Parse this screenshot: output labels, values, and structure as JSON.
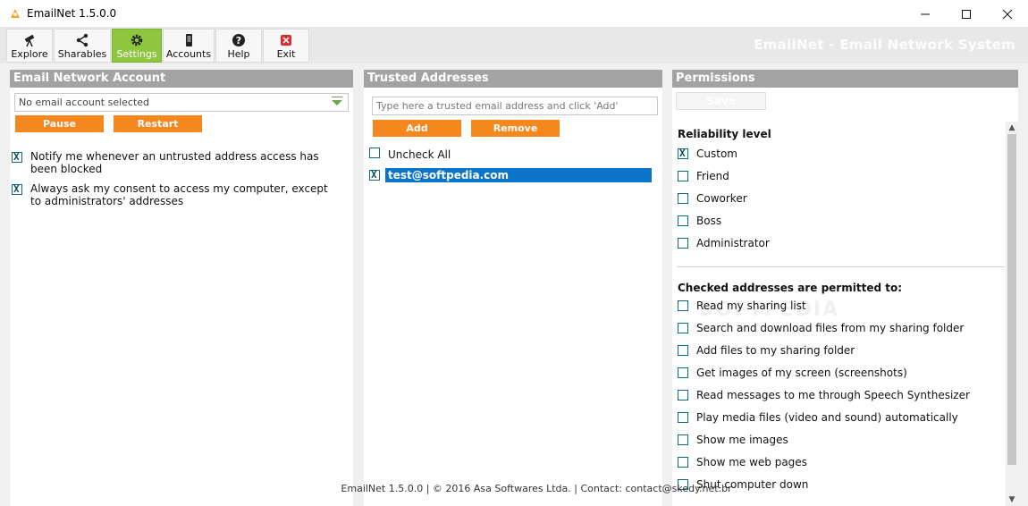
{
  "window": {
    "title": "EmailNet 1.5.0.0",
    "icon": "app-logo-icon"
  },
  "toolbar": {
    "items": [
      {
        "label": "Explore",
        "icon": "telescope-icon"
      },
      {
        "label": "Sharables",
        "icon": "share-icon"
      },
      {
        "label": "Settings",
        "icon": "gear-icon"
      },
      {
        "label": "Accounts",
        "icon": "phone-icon"
      },
      {
        "label": "Help",
        "icon": "question-icon"
      },
      {
        "label": "Exit",
        "icon": "close-icon"
      }
    ],
    "active": "Settings",
    "brand": "EmailNet - Email Network System",
    "active_color": "#8dc63f"
  },
  "account_panel": {
    "title": "Email Network Account",
    "account_select": "No email account selected",
    "pause_label": "Pause",
    "restart_label": "Restart",
    "options": [
      {
        "label": "Notify me whenever an untrusted address access has been blocked",
        "checked": true
      },
      {
        "label": "Always ask my consent to access my computer, except to administrators' addresses",
        "checked": true
      }
    ]
  },
  "trusted_panel": {
    "title": "Trusted Addresses",
    "input_placeholder": "Type here a trusted email address and click 'Add'",
    "add_label": "Add",
    "remove_label": "Remove",
    "uncheck_all_label": "Uncheck All",
    "addresses": [
      {
        "email": "test@softpedia.com",
        "checked": true
      }
    ]
  },
  "permissions_panel": {
    "title": "Permissions",
    "save_label": "Save",
    "reliability_title": "Reliability level",
    "reliability_levels": [
      {
        "label": "Custom",
        "checked": true
      },
      {
        "label": "Friend",
        "checked": false
      },
      {
        "label": "Coworker",
        "checked": false
      },
      {
        "label": "Boss",
        "checked": false
      },
      {
        "label": "Administrator",
        "checked": false
      }
    ],
    "permitted_title": "Checked addresses are permitted to:",
    "permissions": [
      {
        "label": "Read my sharing list",
        "checked": false
      },
      {
        "label": "Search and download files from my sharing folder",
        "checked": false
      },
      {
        "label": "Add files to my sharing folder",
        "checked": false
      },
      {
        "label": "Get images of my screen (screenshots)",
        "checked": false
      },
      {
        "label": "Read messages to me through Speech Synthesizer",
        "checked": false
      },
      {
        "label": "Play media files (video and sound) automatically",
        "checked": false
      },
      {
        "label": "Show me images",
        "checked": false
      },
      {
        "label": "Show me web pages",
        "checked": false
      },
      {
        "label": "Shut computer down",
        "checked": false
      }
    ],
    "watermark": "SOFTPEDIA"
  },
  "footer": {
    "text": "EmailNet 1.5.0.0  |  © 2016 Asa Softwares Ltda.  |  Contact: contact@skedy.net.br"
  },
  "colors": {
    "accent_orange": "#f5871f",
    "selection_blue": "#0a74c9",
    "header_gray": "#a3a3a3"
  }
}
